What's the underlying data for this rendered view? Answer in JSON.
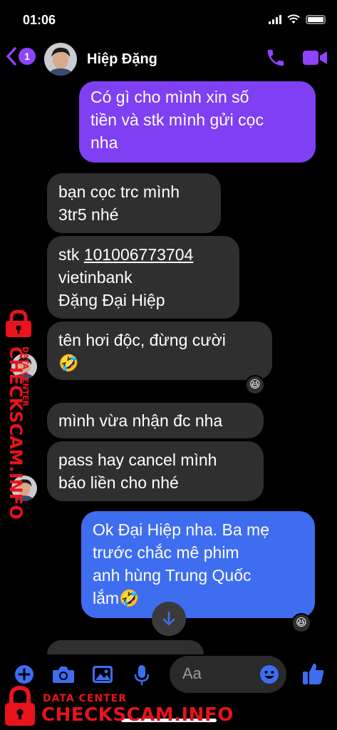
{
  "status_bar": {
    "time": "01:06"
  },
  "header": {
    "back_badge": "1",
    "contact_name": "Hiệp Đặng"
  },
  "messages": [
    {
      "lines": [
        "Có gì cho mình xin số",
        "tiền và stk mình gửi cọc",
        "nha"
      ]
    },
    {
      "lines": [
        "bạn cọc trc mình",
        "3tr5 nhé"
      ]
    },
    {
      "prefix": "stk ",
      "account": "101006773704",
      "lines": [
        "vietinbank",
        "Đặng Đại Hiệp"
      ]
    },
    {
      "lines": [
        "tên hơi độc, đừng cười",
        "🤣"
      ],
      "reaction": "😆"
    },
    {
      "lines": [
        "mình vừa nhận đc nha"
      ]
    },
    {
      "lines": [
        "pass hay cancel mình",
        "báo liền cho nhé"
      ]
    },
    {
      "lines": [
        "Ok Đại Hiệp nha. Ba mẹ",
        "trước chắc mê phim",
        "anh hùng Trung Quốc",
        "lắm🤣"
      ],
      "reaction": "😆"
    }
  ],
  "composer": {
    "placeholder": "Aa"
  },
  "watermark": {
    "small": "DATA CENTER",
    "big": "CHECKSCAM.INFO",
    "side_small": "DATA CENTER",
    "side_big": "CHECKSCAM.INFO"
  },
  "colors": {
    "accent": "#8e44ff",
    "outgoing_purple": "#7f3ff2",
    "outgoing_blue": "#3e6df0",
    "incoming": "#2f2f2f",
    "watermark_red": "#e8131b"
  },
  "icons": [
    "chevron-left-icon",
    "phone-icon",
    "video-camera-icon",
    "arrow-down-icon",
    "plus-icon",
    "camera-icon",
    "image-icon",
    "microphone-icon",
    "emoji-icon",
    "thumbs-up-icon",
    "lock-icon"
  ]
}
